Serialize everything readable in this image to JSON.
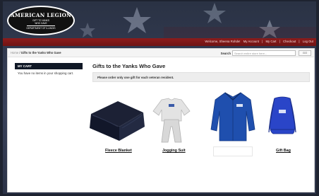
{
  "header": {
    "logo": {
      "title": "AMERICAN LEGION",
      "subtitle_lines": [
        "GIFT TO YANKS",
        "WHO GAVE"
      ],
      "department": "DEPARTMENT OF ILLINOIS"
    },
    "links": [
      "Welcome, Sheena Rohde!",
      "My Account",
      "My Cart",
      "Checkout",
      "Log Out"
    ]
  },
  "breadcrumb": {
    "home": "Home",
    "separator": " / ",
    "current": "Gifts to the Yanks Who Gave"
  },
  "search": {
    "label": "Search",
    "placeholder": "Search entire store here...",
    "button": "GO"
  },
  "sidebar": {
    "cart_title": "MY CART",
    "cart_message": "You have no items in your shopping cart."
  },
  "main": {
    "title": "Gifts to the Yanks Who Gave",
    "notice": "Please order only one gift for each veteran resident.",
    "products": [
      {
        "name": "Fleece Blanket",
        "icon": "blanket-image"
      },
      {
        "name": "Jogging Suit",
        "icon": "jogging-suit-image"
      },
      {
        "name": "",
        "icon": "jacket-image"
      },
      {
        "name": "Gift Bag",
        "icon": "gift-bag-image"
      }
    ]
  },
  "colors": {
    "header_bar": "#8c1c1c",
    "cart_header": "#101826",
    "background": "#2a3244"
  }
}
